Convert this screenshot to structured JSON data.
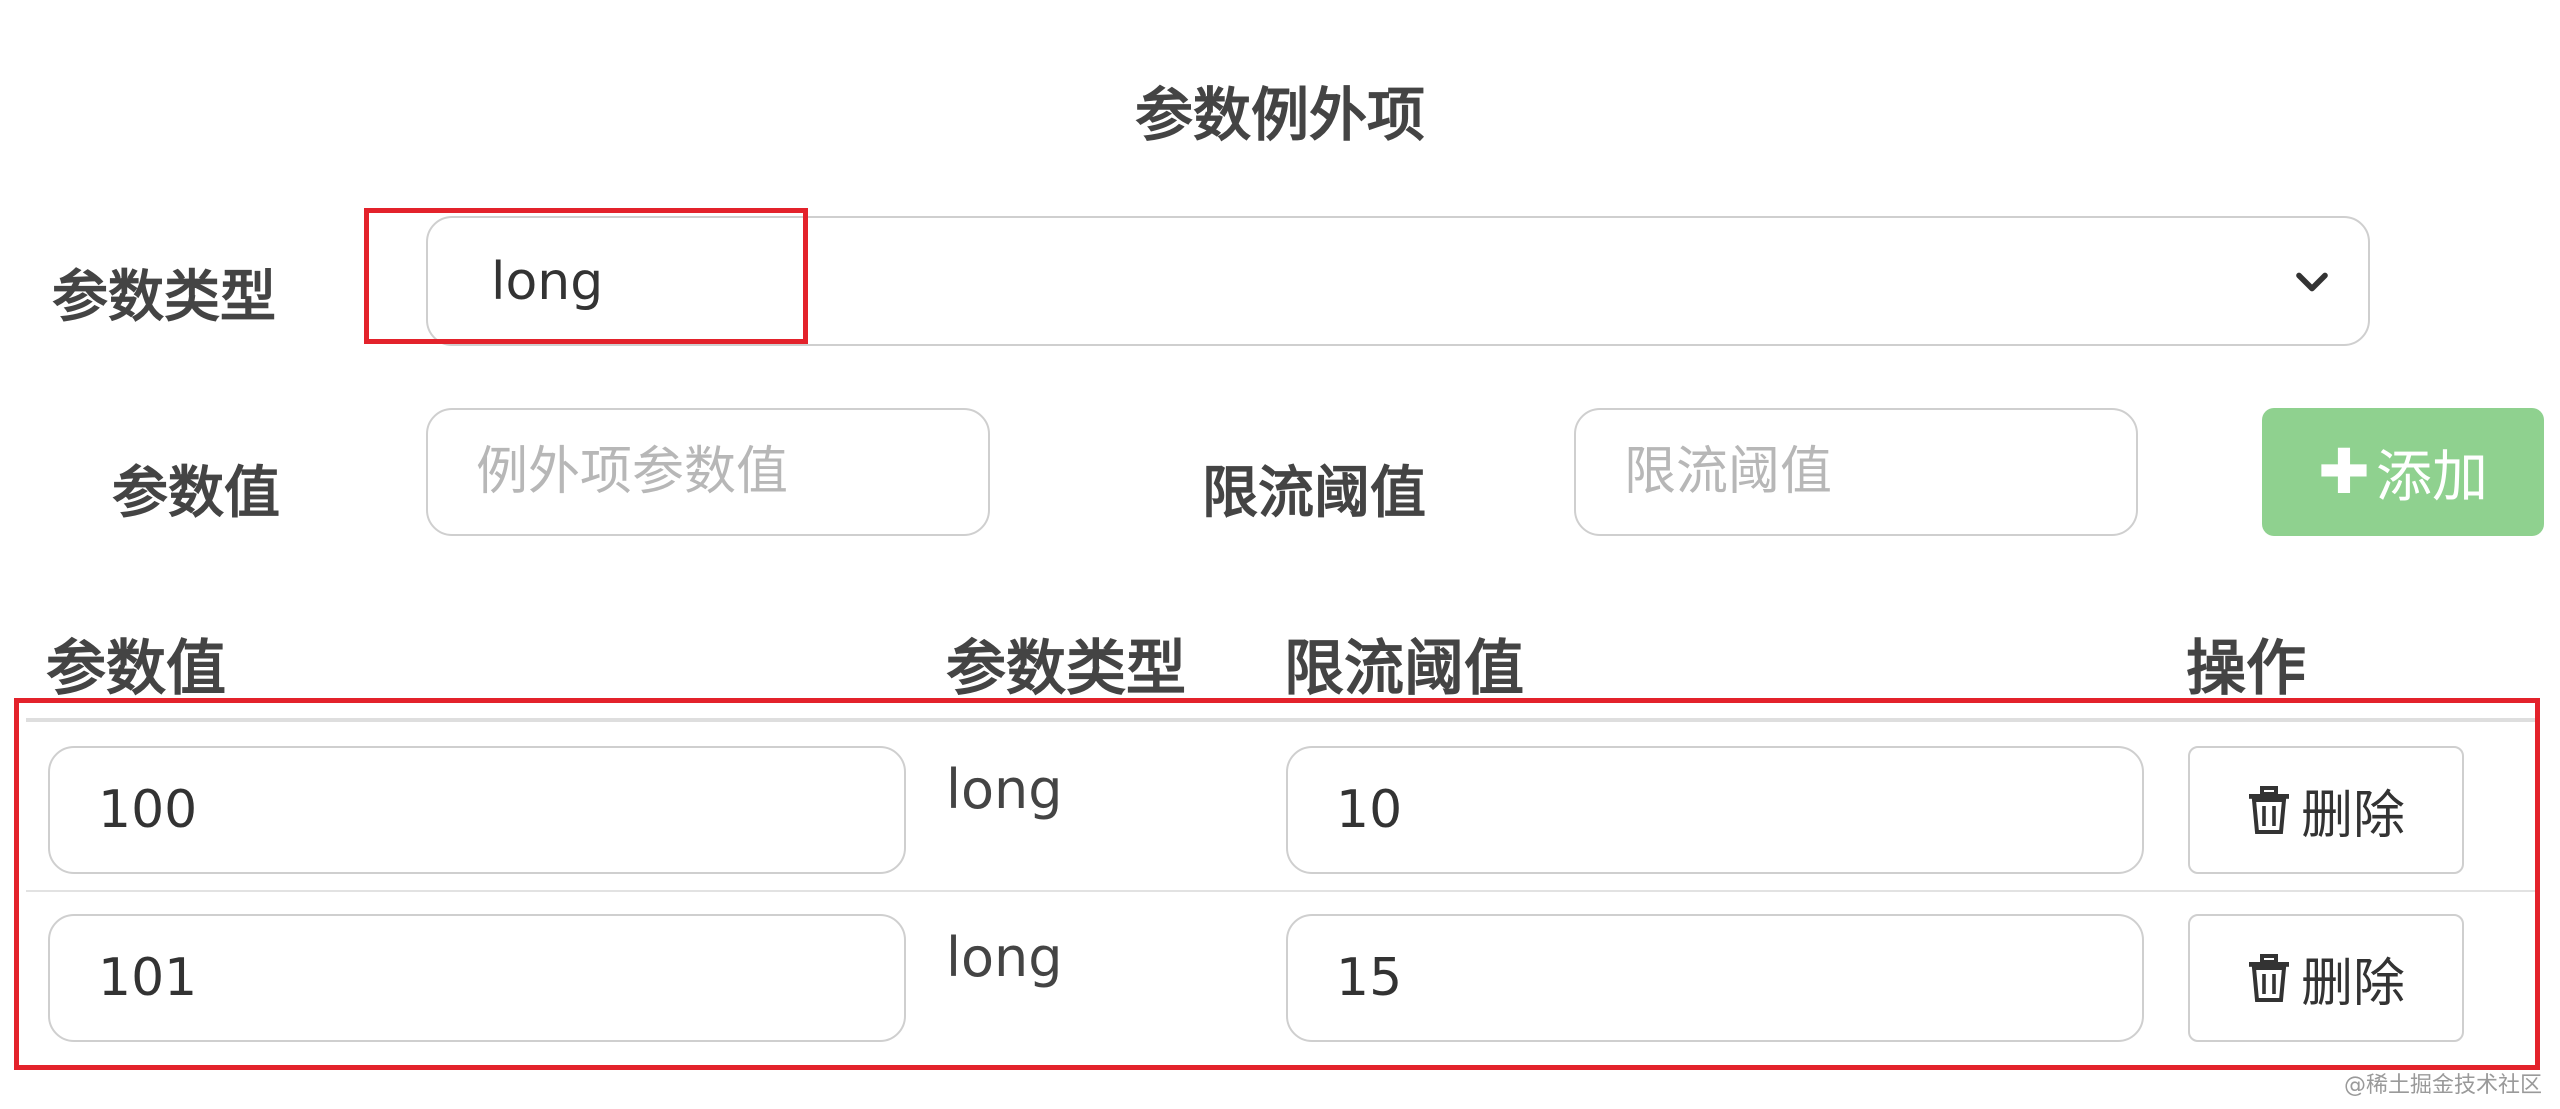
{
  "title": "参数例外项",
  "form": {
    "param_type_label": "参数类型",
    "param_type_value": "long",
    "param_value_label": "参数值",
    "param_value_placeholder": "例外项参数值",
    "threshold_label": "限流阈值",
    "threshold_placeholder": "限流阈值",
    "add_button": "添加"
  },
  "table": {
    "columns": [
      "参数值",
      "参数类型",
      "限流阈值",
      "操作"
    ],
    "rows": [
      {
        "param_value": "100",
        "param_type": "long",
        "threshold": "10",
        "action": "删除"
      },
      {
        "param_value": "101",
        "param_type": "long",
        "threshold": "15",
        "action": "删除"
      }
    ]
  },
  "watermark": "@稀土掘金技术社区",
  "icons": {
    "chevron": "chevron-down-icon",
    "plus": "plus-icon",
    "trash": "trash-icon"
  },
  "colors": {
    "add_button": "#8fd18f",
    "highlight": "#e3222b"
  }
}
